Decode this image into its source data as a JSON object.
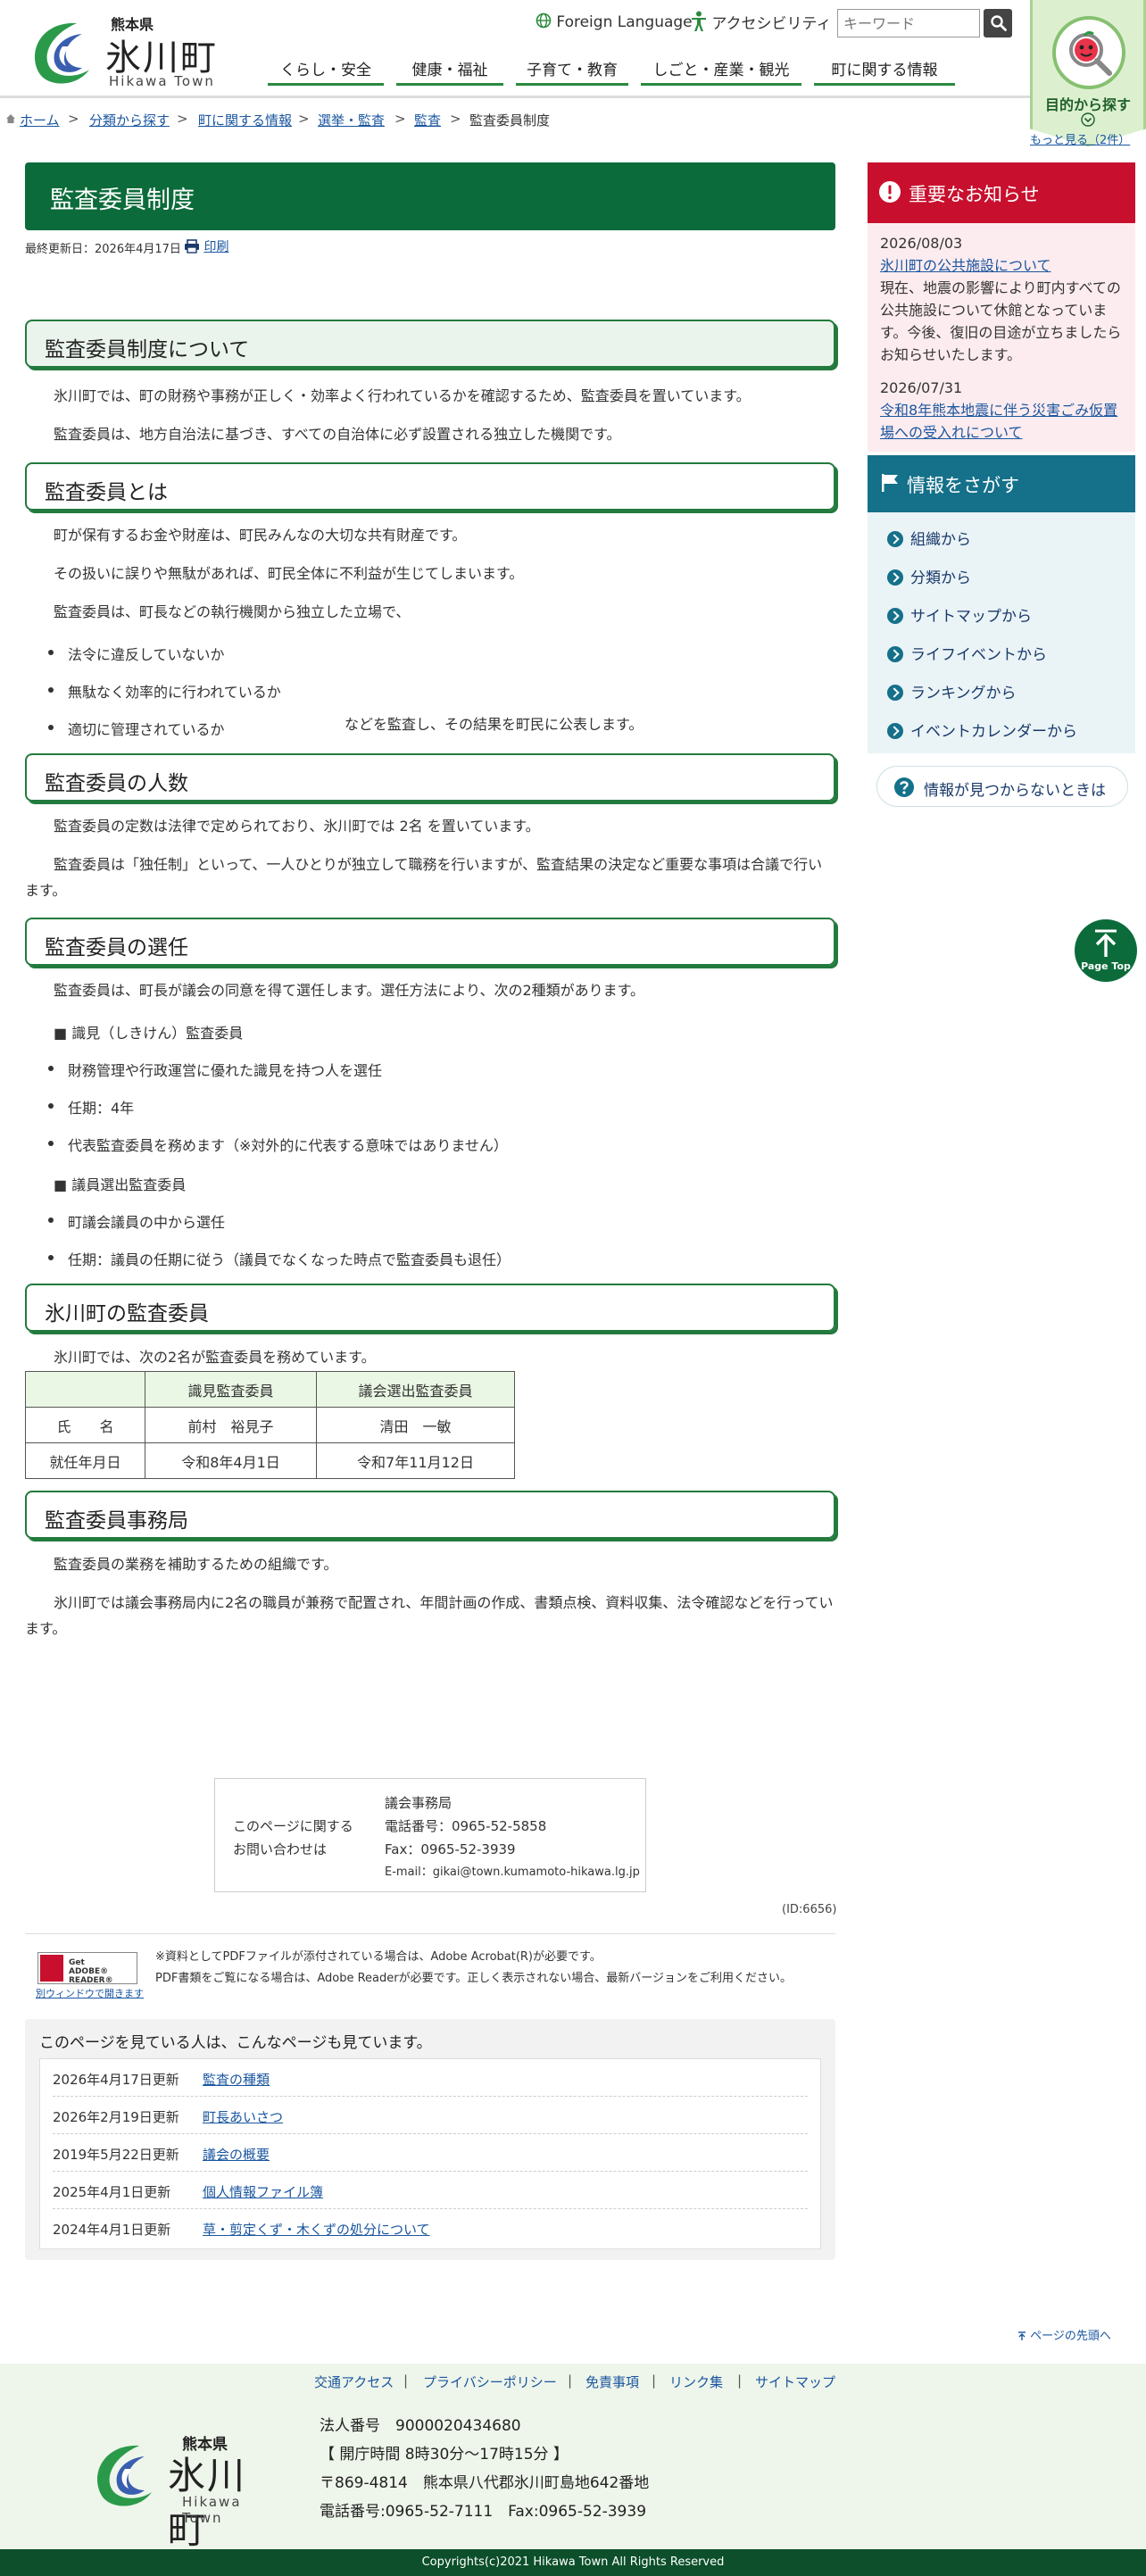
{
  "header": {
    "logo_pref": "熊本県",
    "logo_town": "氷川町",
    "logo_en": "Hikawa Town",
    "foreign_language": "Foreign Language",
    "accessibility": "アクセシビリティ",
    "search_placeholder": "キーワード",
    "nav": [
      "くらし・安全",
      "健康・福祉",
      "子育て・教育",
      "しごと・産業・観光",
      "町に関する情報"
    ],
    "purpose_label": "目的から探す"
  },
  "breadcrumb": [
    "ホーム",
    "分類から探す",
    "町に関する情報",
    "選挙・監査",
    "監査",
    "監査委員制度"
  ],
  "page": {
    "title": "監査委員制度",
    "updated": "最終更新日：2026年4月17日",
    "print": "印刷"
  },
  "sections": {
    "s1": {
      "heading": "監査委員制度について",
      "p1": "氷川町では、町の財務や事務が正しく・効率よく行われているかを確認するため、監査委員を置いています。",
      "p2": "監査委員は、地方自治法に基づき、すべての自治体に必ず設置される独立した機関です。"
    },
    "s2": {
      "heading": "監査委員とは",
      "p1": "町が保有するお金や財産は、町民みんなの大切な共有財産です。",
      "p2": "その扱いに誤りや無駄があれば、町民全体に不利益が生じてしまいます。",
      "p3": "監査委員は、町長などの執行機関から独立した立場で、",
      "li1": "法令に違反していないか",
      "li2": "無駄なく効率的に行われているか",
      "li3": "適切に管理されているか",
      "li3_tail": "などを監査し、その結果を町民に公表します。"
    },
    "s3": {
      "heading": "監査委員の人数",
      "p1": "監査委員の定数は法律で定められており、氷川町では 2名 を置いています。",
      "p2a": "監査委員は「独任制」といって、一人ひとりが独立して職務を行いますが、監査結果の決定など重要な事項は合議で行い",
      "p2b": "ます。"
    },
    "s4": {
      "heading": "監査委員の選任",
      "p1": "監査委員は、町長が議会の同意を得て選任します。選任方法により、次の2種類があります。",
      "t1": "■ 識見（しきけん）監査委員",
      "t1_li1": "財務管理や行政運営に優れた識見を持つ人を選任",
      "t1_li2": "任期：4年",
      "t1_li3": "代表監査委員を務めます（※対外的に代表する意味ではありません）",
      "t2": "■ 議員選出監査委員",
      "t2_li1": "町議会議員の中から選任",
      "t2_li2": "任期：議員の任期に従う（議員でなくなった時点で監査委員も退任）"
    },
    "s5": {
      "heading": "氷川町の監査委員",
      "p1": "氷川町では、次の2名が監査委員を務めています。"
    },
    "s6": {
      "heading": "監査委員事務局",
      "p1": "監査委員の業務を補助するための組織です。",
      "p2a": "氷川町では議会事務局内に2名の職員が兼務で配置され、年間計画の作成、書類点検、資料収集、法令確認などを行ってい",
      "p2b": "ます。"
    }
  },
  "members_table": {
    "headers": [
      "",
      "識見監査委員",
      "議会選出監査委員"
    ],
    "rows": [
      [
        "氏　　名",
        "前村　裕見子",
        "清田　一敏"
      ],
      [
        "就任年月日",
        "令和8年4月1日",
        "令和7年11月12日"
      ]
    ]
  },
  "contact": {
    "label1": "このページに関する",
    "label2": "お問い合わせは",
    "dept": "議会事務局",
    "tel": "電話番号：0965-52-5858",
    "fax": "Fax：0965-52-3939",
    "email": "E-mail：gikai@town.kumamoto-hikawa.lg.jp"
  },
  "page_id": "(ID:6656)",
  "adobe": {
    "badge1": "Get",
    "badge2": "ADOBE® READER®",
    "window": "別ウィンドウで開きます",
    "note1": "※資料としてPDFファイルが添付されている場合は、Adobe Acrobat(R)が必要です。",
    "note2": "PDF書類をご覧になる場合は、Adobe Readerが必要です。正しく表示されない場合、最新バージョンをご利用ください。"
  },
  "related": {
    "title": "このページを見ている人は、こんなページも見ています。",
    "items": [
      {
        "date": "2026年4月17日更新",
        "label": "監査の種類"
      },
      {
        "date": "2026年2月19日更新",
        "label": "町長あいさつ"
      },
      {
        "date": "2019年5月22日更新",
        "label": "議会の概要"
      },
      {
        "date": "2025年4月1日更新",
        "label": "個人情報ファイル簿"
      },
      {
        "date": "2024年4月1日更新",
        "label": "草・剪定くず・木くずの処分について"
      }
    ]
  },
  "sidebar": {
    "notice_title": "重要なお知らせ",
    "more": "もっと見る（2件）",
    "notices": [
      {
        "date": "2026/08/03",
        "link": "氷川町の公共施設について",
        "body": "現在、地震の影響により町内すべての公共施設について休館となっています。今後、復旧の目途が立ちましたらお知らせいたします。"
      },
      {
        "date": "2026/07/31",
        "link": "令和8年熊本地震に伴う災害ごみ仮置場への受入れについて"
      }
    ],
    "find_title": "情報をさがす",
    "find_items": [
      "組織から",
      "分類から",
      "サイトマップから",
      "ライフイベントから",
      "ランキングから",
      "イベントカレンダーから"
    ],
    "not_found": "情報が見つからないときは",
    "page_top": "Page Top"
  },
  "to_top": "ページの先頭へ",
  "footer": {
    "links": [
      "交通アクセス",
      "プライバシーポリシー",
      "免責事項",
      "リンク集",
      "サイトマップ"
    ],
    "logo_pref": "熊本県",
    "logo_town": "氷川町",
    "logo_en": "Hikawa Town",
    "corp_no": "法人番号　9000020434680",
    "hours": "【 開庁時間 8時30分～17時15分 】",
    "address": "〒869-4814　熊本県八代郡氷川町島地642番地",
    "phone": "電話番号:0965-52-7111　Fax:0965-52-3939",
    "copyright": "Copyrights(c)2021 Hikawa Town All Rights Reserved"
  },
  "colors": {
    "brand_green": "#0c6b3a",
    "notice_red": "#c8102e",
    "find_teal": "#15708a"
  }
}
